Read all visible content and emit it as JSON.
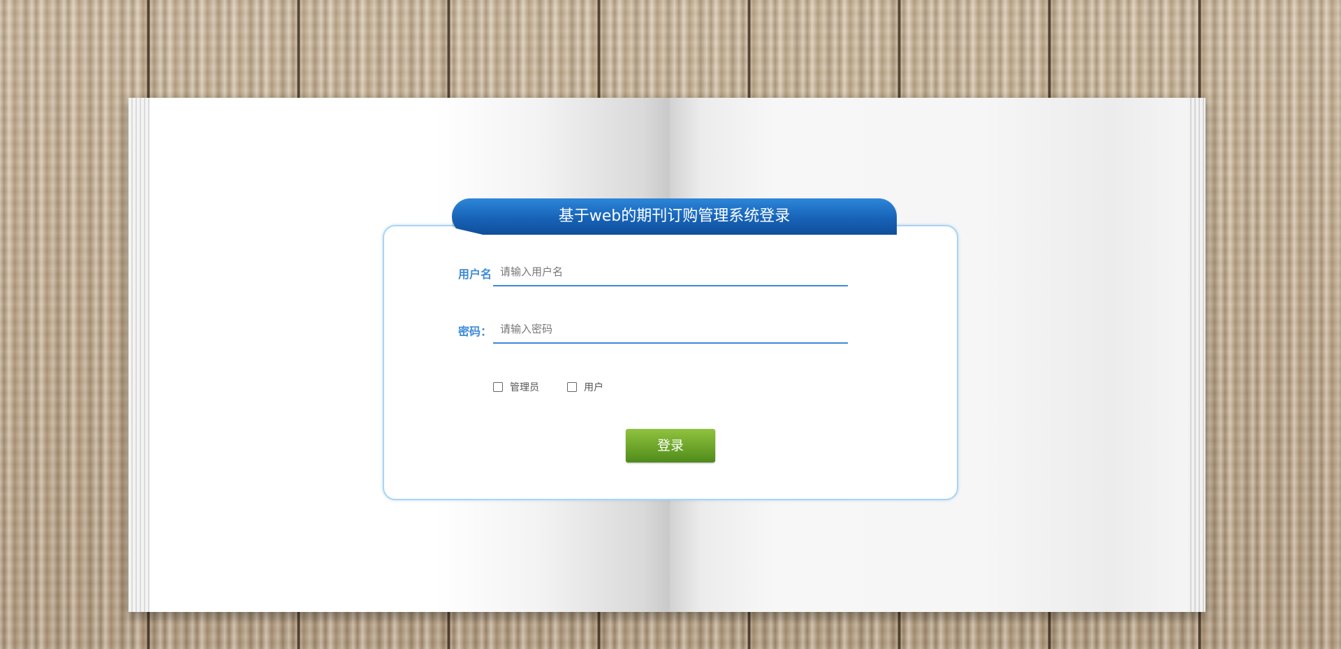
{
  "login": {
    "title": "基于web的期刊订购管理系统登录",
    "username": {
      "label": "用户名",
      "placeholder": "请输入用户名",
      "value": ""
    },
    "password": {
      "label": "密码：",
      "placeholder": "请输入密码",
      "value": ""
    },
    "roles": [
      {
        "label": "管理员",
        "checked": false
      },
      {
        "label": "用户",
        "checked": false
      }
    ],
    "submit_label": "登录"
  },
  "colors": {
    "title_bar": "#1763b8",
    "label_text": "#3e8bd8",
    "input_underline": "#3b89d8",
    "button": "#6da52a",
    "panel_border": "#a9d4f5"
  }
}
